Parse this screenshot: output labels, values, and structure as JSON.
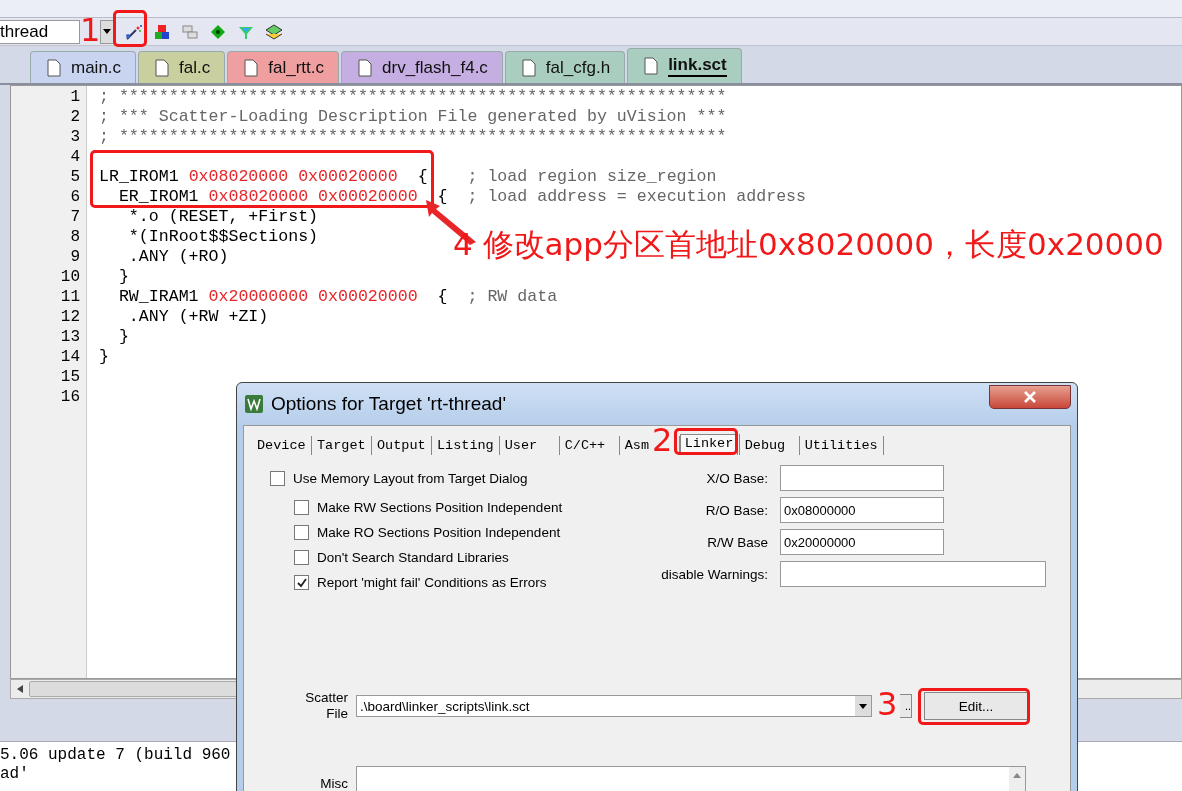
{
  "toolbar": {
    "target": "thread"
  },
  "tabs": [
    {
      "label": "main.c",
      "color": "#c8d4f0",
      "selected": false
    },
    {
      "label": "fal.c",
      "color": "#c9cf9e",
      "selected": false
    },
    {
      "label": "fal_rtt.c",
      "color": "#ef9f9f",
      "selected": false
    },
    {
      "label": "drv_flash_f4.c",
      "color": "#c4aee2",
      "selected": false
    },
    {
      "label": "fal_cfg.h",
      "color": "#a9cdbf",
      "selected": false
    },
    {
      "label": "link.sct",
      "color": "#a9cdbf",
      "selected": true
    }
  ],
  "editor": {
    "lines": [
      {
        "number": "1",
        "tokens": [
          {
            "kind": "comment",
            "text": "; *************************************************************"
          }
        ]
      },
      {
        "number": "2",
        "tokens": [
          {
            "kind": "comment",
            "text": "; *** Scatter-Loading Description File generated by uVision ***"
          }
        ]
      },
      {
        "number": "3",
        "tokens": [
          {
            "kind": "comment",
            "text": "; *************************************************************"
          }
        ]
      },
      {
        "number": "4"
      },
      {
        "number": "5",
        "tokens": [
          {
            "kind": "code",
            "text": "LR_IROM1 "
          },
          {
            "kind": "number",
            "text": "0x08020000 0x00020000"
          },
          {
            "kind": "code",
            "text": "  {    "
          },
          {
            "kind": "comment",
            "text": "; load region size_region"
          }
        ]
      },
      {
        "number": "6",
        "tokens": [
          {
            "kind": "code",
            "text": "  ER_IROM1 "
          },
          {
            "kind": "number",
            "text": "0x08020000 0x00020000"
          },
          {
            "kind": "code",
            "text": "  {  "
          },
          {
            "kind": "comment",
            "text": "; load address = execution address"
          }
        ]
      },
      {
        "number": "7",
        "tokens": [
          {
            "kind": "code",
            "text": "   *.o (RESET, +First)"
          }
        ]
      },
      {
        "number": "8",
        "tokens": [
          {
            "kind": "code",
            "text": "   *(InRoot$$Sections)"
          }
        ]
      },
      {
        "number": "9",
        "tokens": [
          {
            "kind": "code",
            "text": "   .ANY (+RO)"
          }
        ]
      },
      {
        "number": "10",
        "tokens": [
          {
            "kind": "code",
            "text": "  }"
          }
        ]
      },
      {
        "number": "11",
        "tokens": [
          {
            "kind": "code",
            "text": "  RW_IRAM1 "
          },
          {
            "kind": "number",
            "text": "0x20000000 0x00020000"
          },
          {
            "kind": "code",
            "text": "  {  "
          },
          {
            "kind": "comment",
            "text": "; RW data"
          }
        ]
      },
      {
        "number": "12",
        "tokens": [
          {
            "kind": "code",
            "text": "   .ANY (+RW +ZI)"
          }
        ]
      },
      {
        "number": "13",
        "tokens": [
          {
            "kind": "code",
            "text": "  }"
          }
        ]
      },
      {
        "number": "14",
        "tokens": [
          {
            "kind": "code",
            "text": "}"
          }
        ]
      },
      {
        "number": "15"
      },
      {
        "number": "16"
      }
    ]
  },
  "output": {
    "lines": [
      "5.06 update 7 (build 960",
      "ad'"
    ]
  },
  "dialog": {
    "title": "Options for Target 'rt-thread'",
    "tabs": [
      {
        "label": "Device",
        "selected": false
      },
      {
        "label": "Target",
        "selected": false
      },
      {
        "label": "Output",
        "selected": false
      },
      {
        "label": "Listing",
        "selected": false
      },
      {
        "label": "User",
        "selected": false
      },
      {
        "label": "C/C++",
        "selected": false
      },
      {
        "label": "Asm",
        "selected": false
      },
      {
        "label": "Linker",
        "selected": true
      },
      {
        "label": "Debug",
        "selected": false
      },
      {
        "label": "Utilities",
        "selected": false
      }
    ],
    "options": [
      {
        "label": "Use Memory Layout from Target Dialog",
        "checked": false,
        "children": [
          {
            "label": "Make RW Sections Position Independent",
            "checked": false
          },
          {
            "label": "Make RO Sections Position Independent",
            "checked": false
          },
          {
            "label": "Don't Search Standard Libraries",
            "checked": false
          },
          {
            "label": "Report 'might fail' Conditions as Errors",
            "checked": true
          }
        ]
      }
    ],
    "fields": [
      {
        "label": "X/O Base:",
        "kind": "short"
      },
      {
        "label": "R/O Base:",
        "value": "0x08000000",
        "kind": "short"
      },
      {
        "label": "R/W Base",
        "value": "0x20000000",
        "kind": "short"
      },
      {
        "label": "disable Warnings:",
        "kind": "long"
      }
    ],
    "scatter": {
      "label": "Scatter File",
      "value": ".\\board\\linker_scripts\\link.sct",
      "browse": "..",
      "edit": "Edit..."
    },
    "misc": {
      "label": "Misc"
    }
  },
  "annotations": [
    {
      "kind": "step",
      "text": "1"
    },
    {
      "kind": "step",
      "text": "2"
    },
    {
      "kind": "step",
      "text": "3"
    },
    {
      "kind": "note",
      "text": "4 修改app分区首地址0x8020000，长度0x20000"
    }
  ]
}
